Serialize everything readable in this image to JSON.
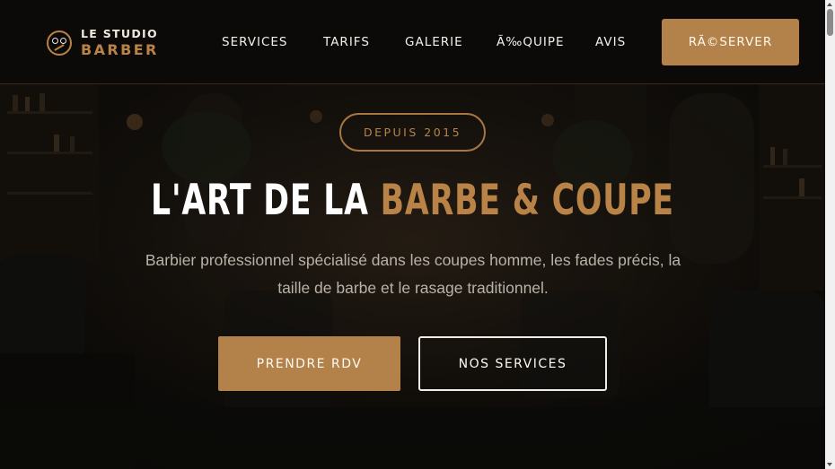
{
  "header": {
    "logo": {
      "top": "LE STUDIO",
      "bottom": "BARBER"
    },
    "nav": [
      {
        "label": "SERVICES"
      },
      {
        "label": "TARIFS"
      },
      {
        "label": "GALERIE"
      },
      {
        "label": "Ã‰QUIPE"
      },
      {
        "label": "AVIS"
      }
    ],
    "cta": "RÃ©SERVER"
  },
  "hero": {
    "badge": "DEPUIS 2015",
    "headline_white": "L'ART DE LA",
    "headline_accent": "BARBE & COUPE",
    "subtitle": "Barbier professionnel spécialisé dans les coupes homme, les fades précis, la taille de barbe et le rasage traditionnel.",
    "primary_button": "PRENDRE RDV",
    "secondary_button": "NOS SERVICES"
  },
  "colors": {
    "accent": "#b98347",
    "accent_button": "#b3824a",
    "header_bg": "#0b0a09",
    "text_light": "#f4efe7",
    "subtitle_text": "#b9b2a8"
  },
  "icons": {
    "logo_icon": "barber-scissors-icon"
  }
}
